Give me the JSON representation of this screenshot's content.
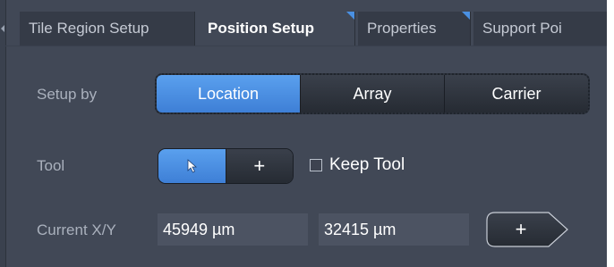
{
  "tabs": [
    {
      "label": "Tile Region Setup",
      "active": false
    },
    {
      "label": "Position Setup",
      "active": true
    },
    {
      "label": "Properties",
      "active": false
    },
    {
      "label": "Support Poi",
      "active": false
    }
  ],
  "setup_by": {
    "label": "Setup by",
    "options": [
      "Location",
      "Array",
      "Carrier"
    ],
    "selected": "Location"
  },
  "tool": {
    "label": "Tool",
    "pointer_icon": "pointer-arrow-icon",
    "add_symbol": "+",
    "selected": "pointer",
    "keep_tool_label": "Keep Tool",
    "keep_tool_checked": false
  },
  "current_xy": {
    "label": "Current X/Y",
    "x_value": "45949 µm",
    "y_value": "32415 µm",
    "add_symbol": "+"
  },
  "colors": {
    "panel_bg": "#414856",
    "accent": "#4a90e2",
    "selected_gradient_top": "#5aa0ee",
    "selected_gradient_bottom": "#3e7fd6"
  }
}
